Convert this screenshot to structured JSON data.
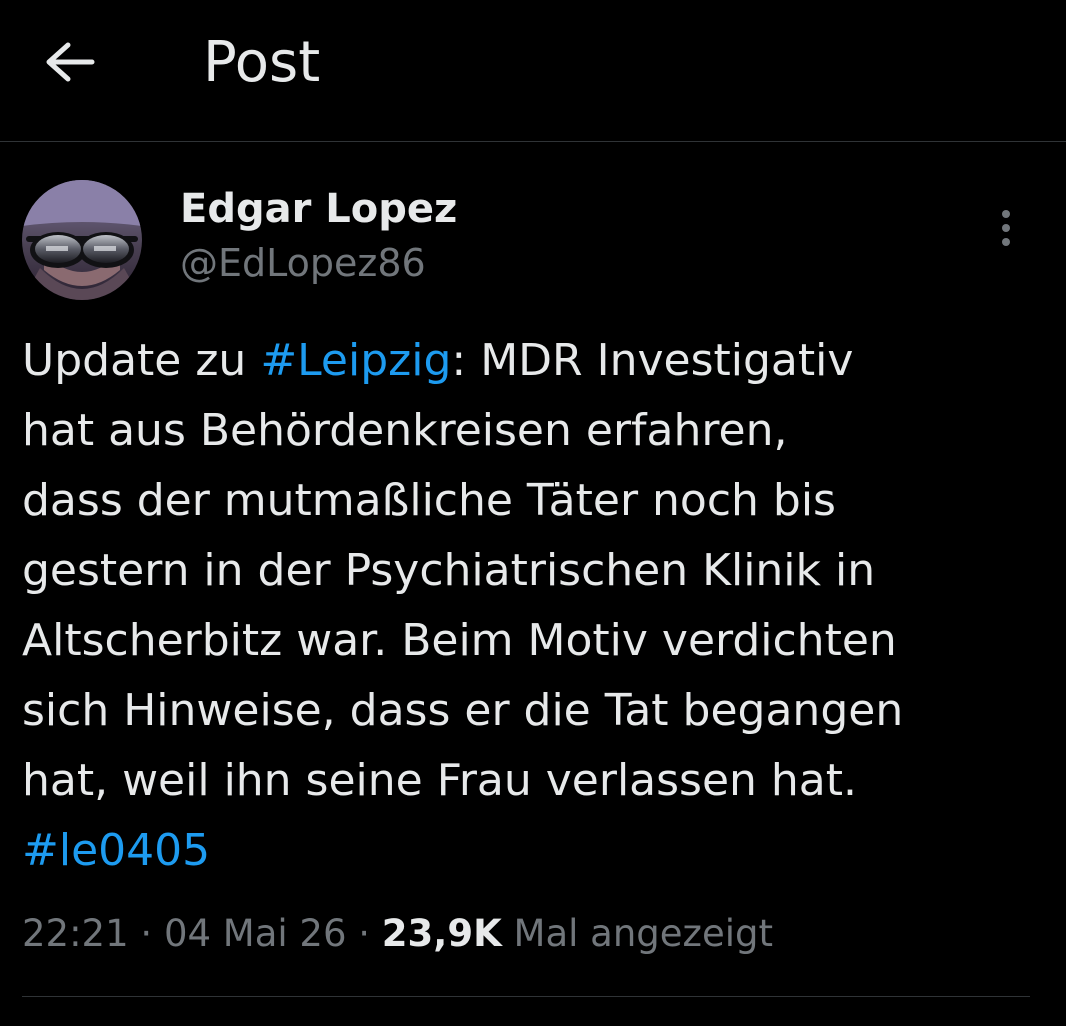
{
  "header": {
    "title": "Post",
    "back_icon": "arrow-left-icon"
  },
  "author": {
    "name": "Edgar Lopez",
    "handle": "@EdLopez86"
  },
  "tweet": {
    "line1_before": "Update zu ",
    "line1_hashtag": "#Leipzig",
    "line1_after": ": MDR Investigativ",
    "line2": "hat aus Behördenkreisen erfahren,",
    "line3": "dass der mutmaßliche Täter noch bis",
    "line4": "gestern in der Psychiatrischen Klinik in",
    "line5": "Altscherbitz war. Beim Motiv verdichten",
    "line6": "sich Hinweise, dass er die Tat begangen",
    "line7": "hat, weil ihn seine Frau verlassen hat.",
    "line8_hashtag": "#le0405"
  },
  "meta": {
    "time": "22:21",
    "separator1": " · ",
    "date": "04 Mai 26",
    "separator2": " · ",
    "views_count": "23,9K",
    "views_label": " Mal angezeigt"
  },
  "colors": {
    "background": "#000000",
    "text": "#e7e9ea",
    "secondary": "#71767b",
    "link": "#1d9bf0",
    "divider": "#2f3336"
  }
}
